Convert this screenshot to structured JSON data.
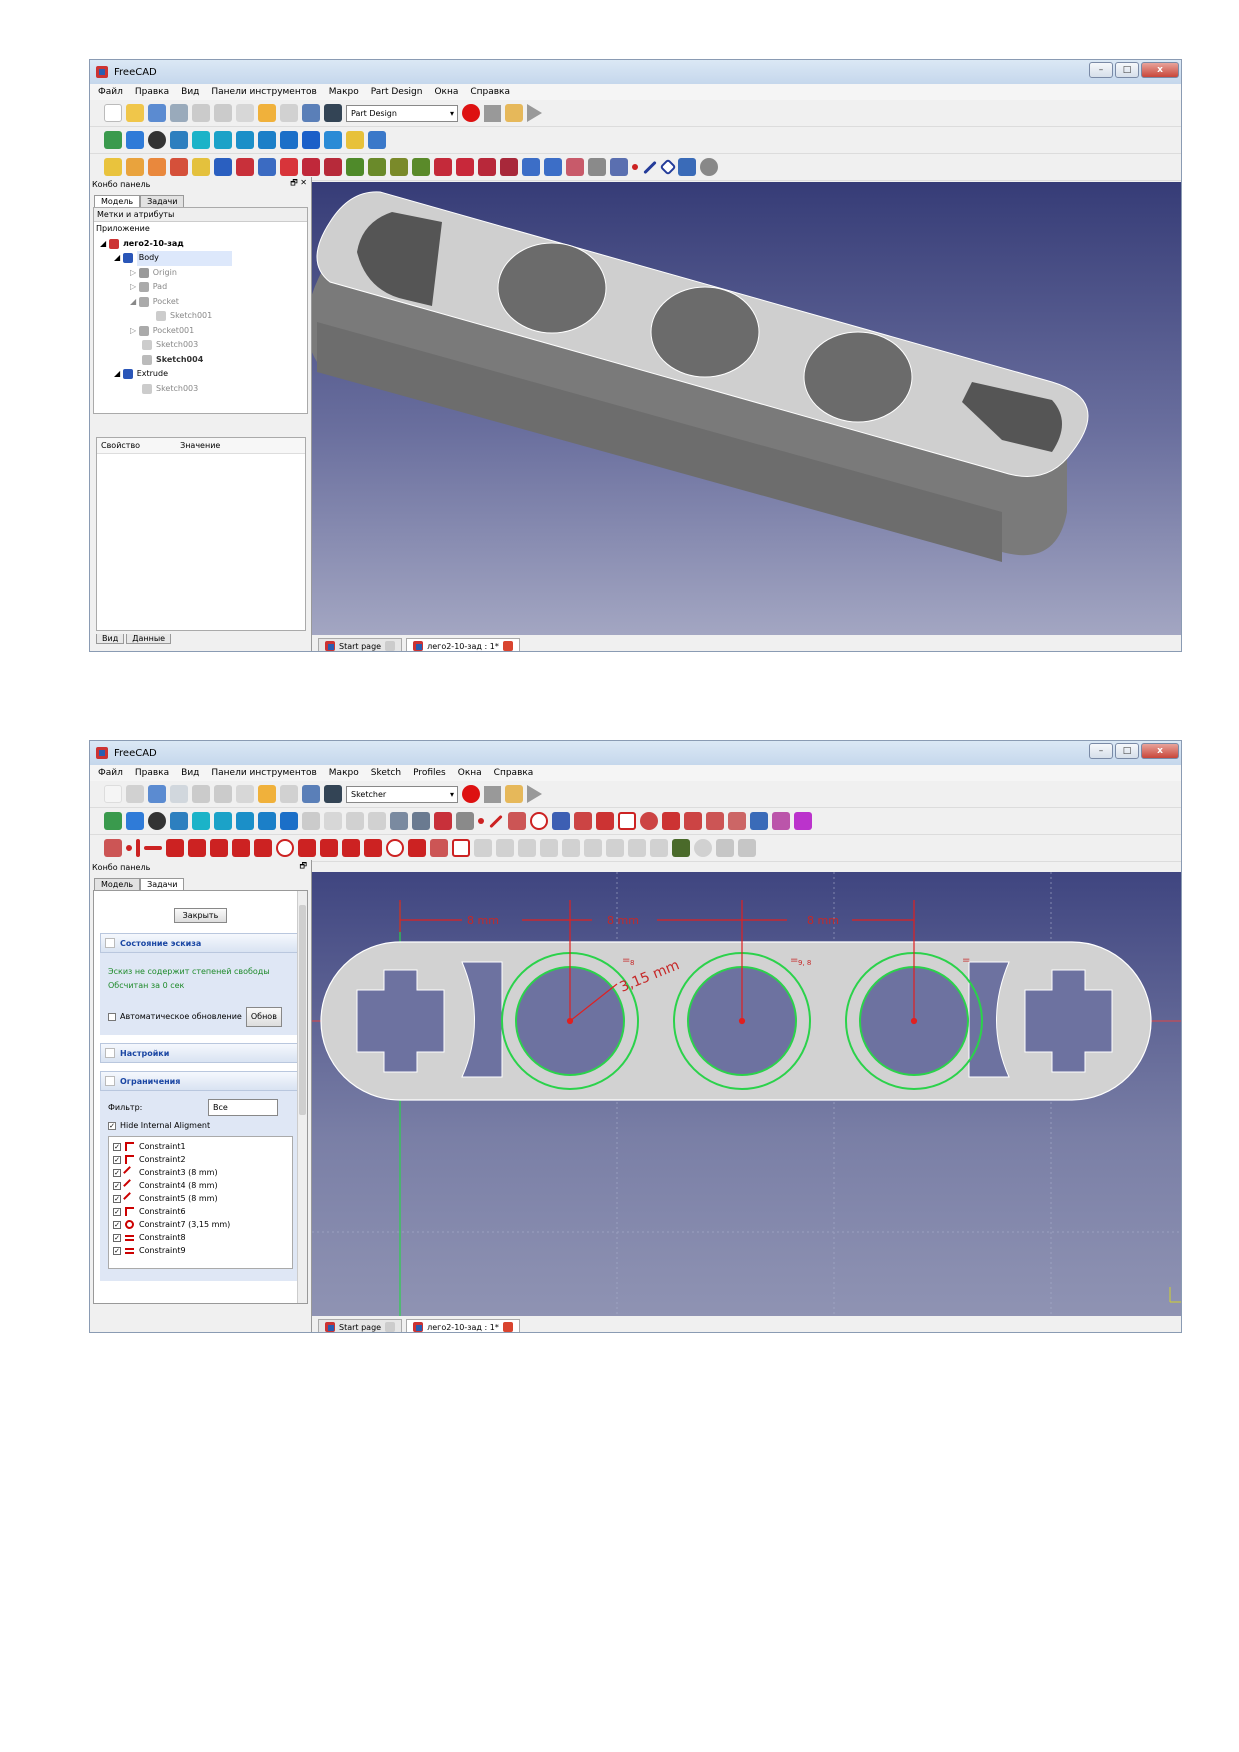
{
  "screenshot_top": {
    "title": "FreeCAD",
    "menu": [
      "Файл",
      "Правка",
      "Вид",
      "Панели инструментов",
      "Макро",
      "Part Design",
      "Окна",
      "Справка"
    ],
    "workbench": "Part Design",
    "panel_title": "Конбо панель",
    "tabs": [
      "Модель",
      "Задачи"
    ],
    "tree_header": "Метки и атрибуты",
    "tree": {
      "root": "Приложение",
      "doc": "лего2-10-зад",
      "body": "Body",
      "origin": "Origin",
      "pad": "Pad",
      "pocket": "Pocket",
      "sketch001a": "Sketch001",
      "pocket001": "Pocket001",
      "sketch003a": "Sketch003",
      "sketch004": "Sketch004",
      "extrude": "Extrude",
      "sketch003b": "Sketch003"
    },
    "props_header": [
      "Свойство",
      "Значение"
    ],
    "bottom_tabs": [
      "Вид",
      "Данные"
    ],
    "doc_tabs": [
      "Start page",
      "лего2-10-зад : 1*"
    ]
  },
  "screenshot_bottom": {
    "title": "FreeCAD",
    "menu": [
      "Файл",
      "Правка",
      "Вид",
      "Панели инструментов",
      "Макро",
      "Sketch",
      "Profiles",
      "Окна",
      "Справка"
    ],
    "workbench": "Sketcher",
    "panel_title": "Конбо панель",
    "tabs": [
      "Модель",
      "Задачи"
    ],
    "close_button": "Закрыть",
    "status_group": "Состояние эскиза",
    "status_line1": "Эскиз не содержит степеней свободы",
    "status_line2": "Обсчитан за 0 сек",
    "auto_update": "Автоматическое обновление",
    "update_button": "Обнов",
    "settings_group": "Настройки",
    "constraints_group": "Ограничения",
    "filter_label": "Фильтр:",
    "filter_value": "Все",
    "hide_internal": "Hide Internal Aligment",
    "constraints": [
      "Constraint1",
      "Constraint2",
      "Constraint3 (8 mm)",
      "Constraint4 (8 mm)",
      "Constraint5 (8 mm)",
      "Constraint6",
      "Constraint7 (3,15 mm)",
      "Constraint8",
      "Constraint9"
    ],
    "dim_labels": [
      "8 mm",
      "8 mm",
      "8 mm",
      "3,15 mm"
    ],
    "eq_labels": [
      "8",
      "9, 8",
      ""
    ],
    "doc_tabs": [
      "Start page",
      "лего2-10-зад : 1*"
    ]
  }
}
